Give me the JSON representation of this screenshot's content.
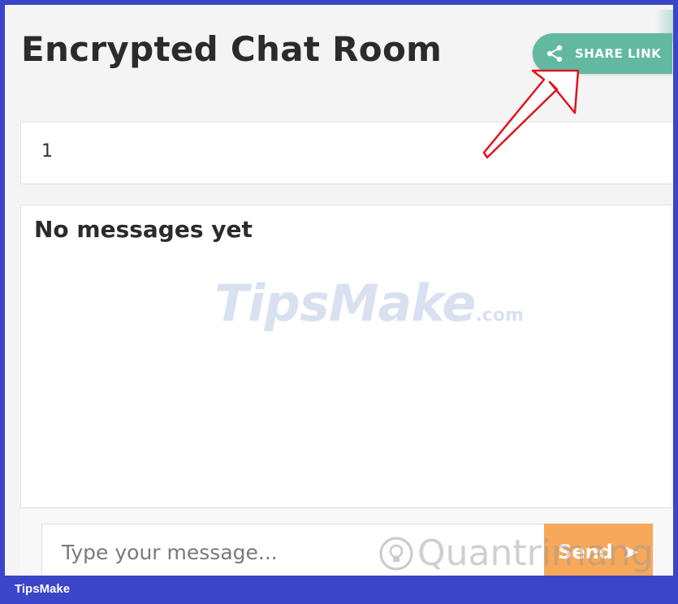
{
  "page": {
    "title": "Encrypted Chat Room",
    "share_label": "SHARE LINK",
    "room_id": "1",
    "empty_state": "No messages yet",
    "input_placeholder": "Type your message...",
    "send_label": "Send",
    "send_arrow": "➤"
  },
  "watermarks": {
    "tipsmake_main": "TipsMake",
    "tipsmake_suffix": ".com",
    "quantrimang": "Quantrimang",
    "brand": "TipsMake"
  },
  "colors": {
    "share": "#62b9a0",
    "send": "#f7a85a",
    "frame": "#3a45c8",
    "annotation_arrow": "#e0141e"
  },
  "icons": {
    "share": "share-icon",
    "send": "send-arrow-icon",
    "scroll_up": "chevron-up-icon",
    "scroll_down": "chevron-down-icon"
  }
}
